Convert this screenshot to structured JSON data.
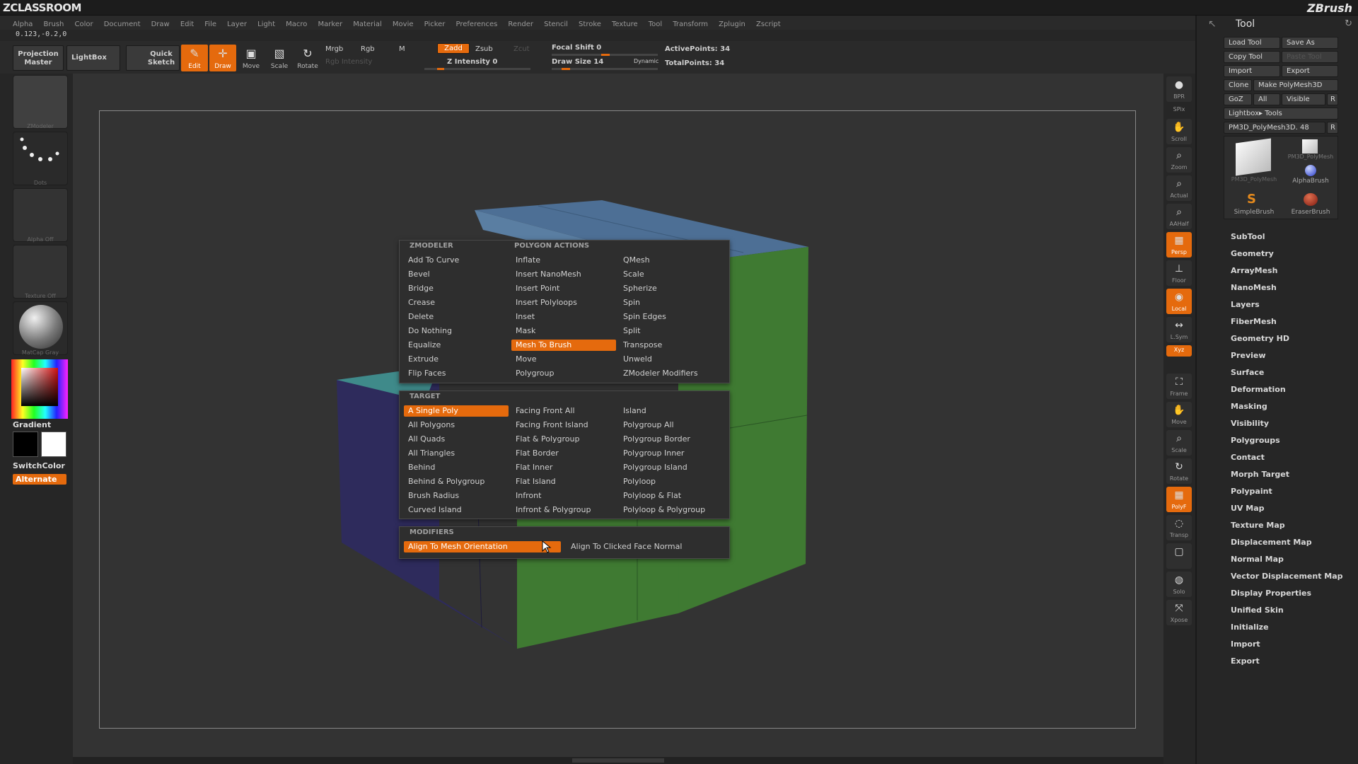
{
  "app": {
    "logo": "ZCLASSROOM",
    "brand": "ZBrush",
    "coords": "0.123,-0.2,0"
  },
  "menu": [
    "Alpha",
    "Brush",
    "Color",
    "Document",
    "Draw",
    "Edit",
    "File",
    "Layer",
    "Light",
    "Macro",
    "Marker",
    "Material",
    "Movie",
    "Picker",
    "Preferences",
    "Render",
    "Stencil",
    "Stroke",
    "Texture",
    "Tool",
    "Transform",
    "Zplugin",
    "Zscript"
  ],
  "toolbar": {
    "projection_master": "Projection Master",
    "lightbox": "LightBox",
    "quick_sketch": "Quick Sketch",
    "edit": "Edit",
    "draw": "Draw",
    "move": "Move",
    "scale": "Scale",
    "rotate": "Rotate",
    "mrgb": "Mrgb",
    "rgb": "Rgb",
    "m": "M",
    "rgb_intensity": "Rgb Intensity",
    "zadd": "Zadd",
    "zsub": "Zsub",
    "zcut": "Zcut",
    "z_intensity": "Z Intensity 0",
    "focal_shift": "Focal Shift 0",
    "draw_size": "Draw Size 14",
    "dynamic": "Dynamic",
    "active_points": "ActivePoints: 34",
    "total_points": "TotalPoints: 34"
  },
  "left_shelf": {
    "zmodeler": "ZModeler",
    "dots": "Dots",
    "alpha": "Alpha  Off",
    "texture": "Texture  Off",
    "matcap": "MatCap  Gray",
    "gradient": "Gradient",
    "switch_color": "SwitchColor",
    "alternate": "Alternate"
  },
  "right_column": [
    {
      "name": "bpr",
      "label": "BPR",
      "icon": "sphere-icon"
    },
    {
      "name": "spix",
      "label": "SPix",
      "icon": ""
    },
    {
      "name": "scroll",
      "label": "Scroll",
      "icon": "hand-icon"
    },
    {
      "name": "zoom",
      "label": "Zoom",
      "icon": "magnifier-icon"
    },
    {
      "name": "actual",
      "label": "Actual",
      "icon": "magnifier-icon"
    },
    {
      "name": "aahalf",
      "label": "AAHalf",
      "icon": "magnifier-icon"
    },
    {
      "name": "persp",
      "label": "Persp",
      "icon": "grid-icon"
    },
    {
      "name": "floor",
      "label": "Floor",
      "icon": "floor-icon"
    },
    {
      "name": "local",
      "label": "Local",
      "icon": "local-icon"
    },
    {
      "name": "lsym",
      "label": "L.Sym",
      "icon": "sym-icon"
    },
    {
      "name": "xyz",
      "label": "Xyz",
      "icon": "xyz-icon"
    },
    {
      "name": "frame",
      "label": "Frame",
      "icon": "frame-icon"
    },
    {
      "name": "move",
      "label": "Move",
      "icon": "hand-icon"
    },
    {
      "name": "scale",
      "label": "Scale",
      "icon": "magnifier-icon"
    },
    {
      "name": "rotate",
      "label": "Rotate",
      "icon": "rotate-icon"
    },
    {
      "name": "polyf",
      "label": "PolyF",
      "icon": "grid-icon"
    },
    {
      "name": "transp",
      "label": "Transp",
      "icon": "transp-icon"
    },
    {
      "name": "ghost",
      "label": "",
      "icon": "ghost-icon"
    },
    {
      "name": "solo",
      "label": "Solo",
      "icon": "solo-icon"
    },
    {
      "name": "xpose",
      "label": "Xpose",
      "icon": "xpose-icon"
    }
  ],
  "tool_panel": {
    "title": "Tool",
    "load_tool": "Load Tool",
    "save_as": "Save As",
    "copy_tool": "Copy Tool",
    "paste_tool": "Paste Tool",
    "import": "Import",
    "export": "Export",
    "clone": "Clone",
    "make_polymesh": "Make PolyMesh3D",
    "goz": "GoZ",
    "all": "All",
    "visible": "Visible",
    "r": "R",
    "lightbox_tools": "Lightbox▸ Tools",
    "current_tool": "PM3D_PolyMesh3D. 48",
    "brushes": [
      "PM3D_PolyMesh",
      "PM3D_PolyMesh",
      "AlphaBrush",
      "SimpleBrush",
      "EraserBrush"
    ],
    "sections": [
      "SubTool",
      "Geometry",
      "ArrayMesh",
      "NanoMesh",
      "Layers",
      "FiberMesh",
      "Geometry HD",
      "Preview",
      "Surface",
      "Deformation",
      "Masking",
      "Visibility",
      "Polygroups",
      "Contact",
      "Morph Target",
      "Polypaint",
      "UV Map",
      "Texture Map",
      "Displacement Map",
      "Normal Map",
      "Vector Displacement Map",
      "Display Properties",
      "Unified Skin",
      "Initialize",
      "Import",
      "Export"
    ]
  },
  "popup": {
    "zmodeler_head": "ZMODELER",
    "actions_head": "POLYGON ACTIONS",
    "actions": [
      [
        "Add To Curve",
        "Inflate",
        "QMesh"
      ],
      [
        "Bevel",
        "Insert NanoMesh",
        "Scale"
      ],
      [
        "Bridge",
        "Insert Point",
        "Spherize"
      ],
      [
        "Crease",
        "Insert Polyloops",
        "Spin"
      ],
      [
        "Delete",
        "Inset",
        "Spin Edges"
      ],
      [
        "Do Nothing",
        "Mask",
        "Split"
      ],
      [
        "Equalize",
        "Mesh To Brush",
        "Transpose"
      ],
      [
        "Extrude",
        "Move",
        "Unweld"
      ],
      [
        "Flip Faces",
        "Polygroup",
        "ZModeler Modifiers"
      ]
    ],
    "target_head": "TARGET",
    "targets": [
      [
        "A Single Poly",
        "Facing Front All",
        "Island"
      ],
      [
        "All Polygons",
        "Facing Front Island",
        "Polygroup All"
      ],
      [
        "All Quads",
        "Flat & Polygroup",
        "Polygroup Border"
      ],
      [
        "All Triangles",
        "Flat Border",
        "Polygroup Inner"
      ],
      [
        "Behind",
        "Flat Inner",
        "Polygroup Island"
      ],
      [
        "Behind & Polygroup",
        "Flat Island",
        "Polyloop"
      ],
      [
        "Brush Radius",
        "Infront",
        "Polyloop & Flat"
      ],
      [
        "Curved Island",
        "Infront & Polygroup",
        "Polyloop & Polygroup"
      ]
    ],
    "modifiers_head": "MODIFIERS",
    "modifiers": [
      "Align To Mesh Orientation",
      "Align To Clicked Face Normal"
    ]
  },
  "colors": {
    "accent": "#e56a0d",
    "cube_top": "#4d6f95",
    "cube_green": "#3f7a32",
    "cube_blue": "#2e2b5c",
    "cube_teal": "#3f8a8a"
  }
}
